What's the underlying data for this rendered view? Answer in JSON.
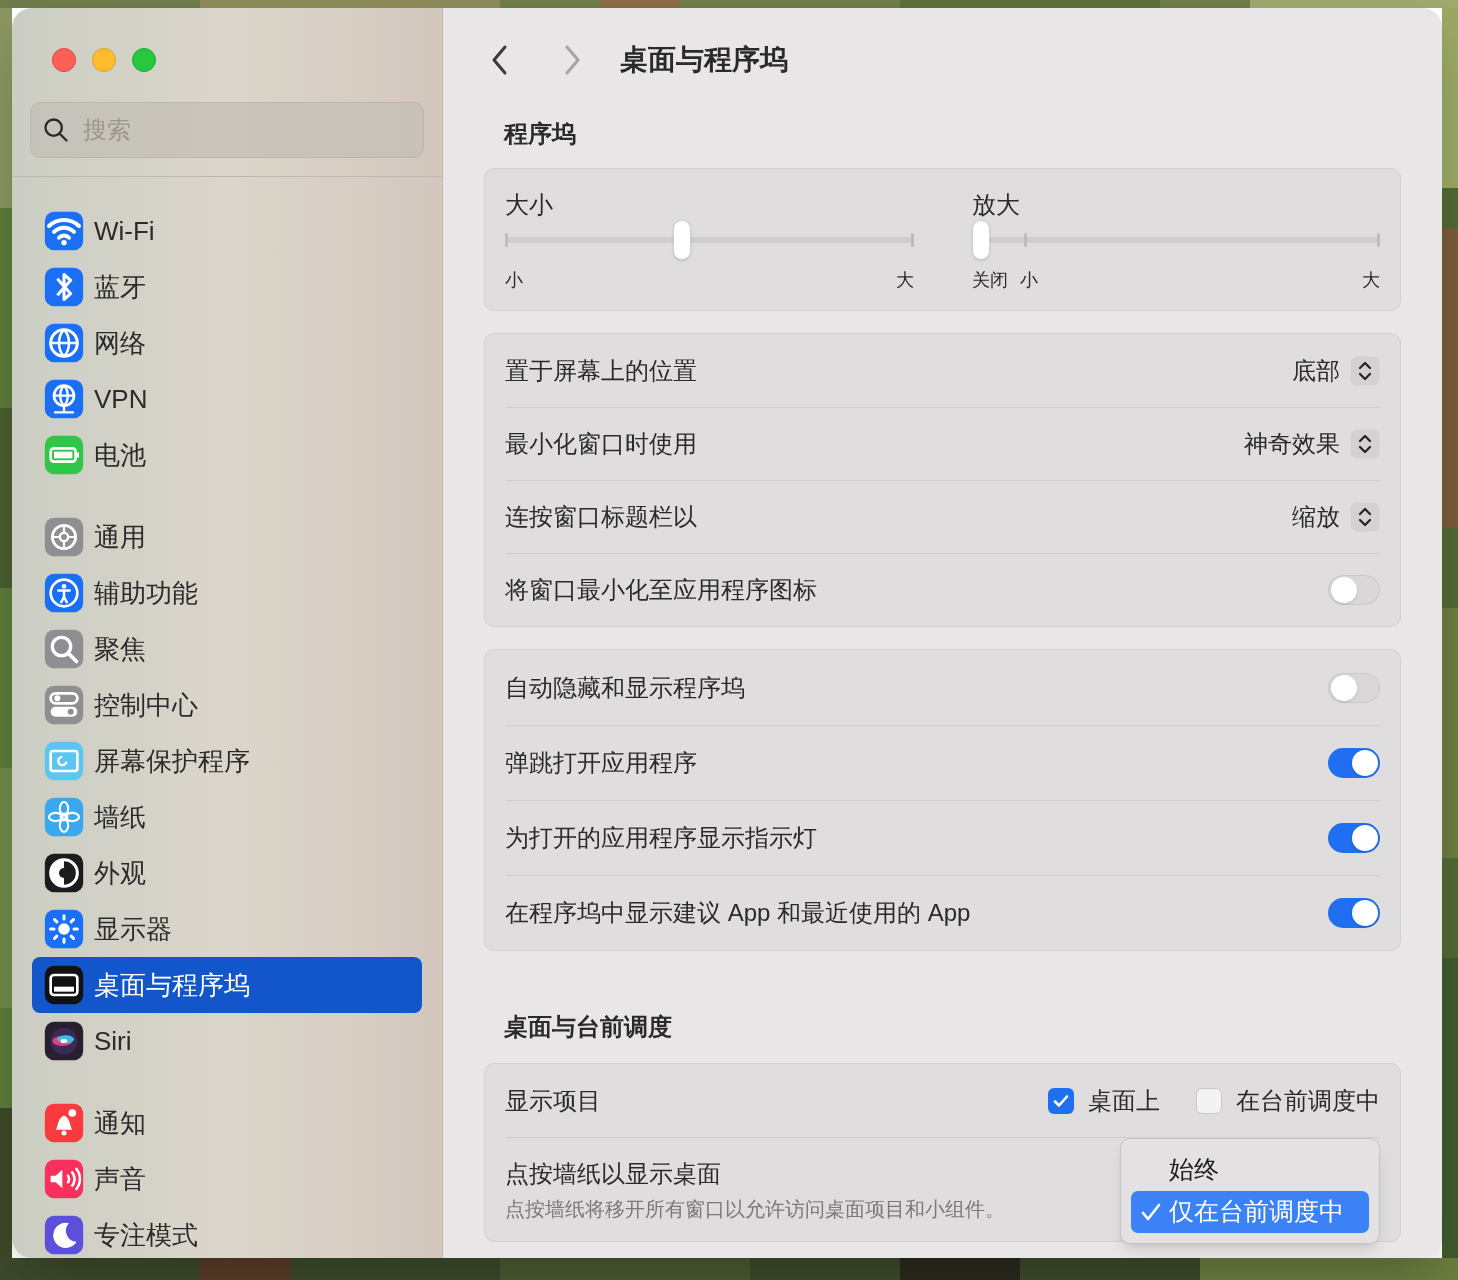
{
  "sidebar": {
    "search": {
      "placeholder": "搜索"
    },
    "groups": [
      [
        {
          "label": "Wi-Fi",
          "color": "#1b6ff5",
          "selected": false
        },
        {
          "label": "蓝牙",
          "color": "#1b6ff5",
          "selected": false
        },
        {
          "label": "网络",
          "color": "#1b6ff5",
          "selected": false
        },
        {
          "label": "VPN",
          "color": "#1b6ff5",
          "selected": false
        },
        {
          "label": "电池",
          "color": "#30c748",
          "selected": false
        }
      ],
      [
        {
          "label": "通用",
          "color": "#8e8e93",
          "selected": false
        },
        {
          "label": "辅助功能",
          "color": "#1b6ff5",
          "selected": false
        },
        {
          "label": "聚焦",
          "color": "#8e8e93",
          "selected": false
        },
        {
          "label": "控制中心",
          "color": "#8e8e93",
          "selected": false
        },
        {
          "label": "屏幕保护程序",
          "color": "#5cc6f2",
          "selected": false
        },
        {
          "label": "墙纸",
          "color": "#3aa8ef",
          "selected": false
        },
        {
          "label": "外观",
          "color": "#1c1c1e",
          "selected": false
        },
        {
          "label": "显示器",
          "color": "#1b6ff5",
          "selected": false
        },
        {
          "label": "桌面与程序坞",
          "color": "#111111",
          "selected": true
        },
        {
          "label": "Siri",
          "color": "#2a1f2e",
          "selected": false
        }
      ],
      [
        {
          "label": "通知",
          "color": "#fb3a3f",
          "selected": false
        },
        {
          "label": "声音",
          "color": "#fb2f5c",
          "selected": false
        },
        {
          "label": "专注模式",
          "color": "#5b4fdc",
          "selected": false
        }
      ]
    ]
  },
  "header": {
    "title": "桌面与程序坞"
  },
  "sections": [
    {
      "title": "程序坞",
      "cards": [
        {
          "kind": "sliders",
          "sliders": [
            {
              "label": "大小",
              "level": 0.43,
              "ticks": [
                "小",
                "大"
              ]
            },
            {
              "label": "放大",
              "level": 0,
              "ticks": [
                "关闭",
                "小",
                "大"
              ]
            }
          ]
        },
        {
          "kind": "rows",
          "rows": [
            {
              "kind": "popup",
              "label": "置于屏幕上的位置",
              "value": "底部"
            },
            {
              "kind": "popup",
              "label": "最小化窗口时使用",
              "value": "神奇效果"
            },
            {
              "kind": "popup",
              "label": "连按窗口标题栏以",
              "value": "缩放"
            },
            {
              "kind": "toggle",
              "label": "将窗口最小化至应用程序图标",
              "on": false
            }
          ]
        },
        {
          "kind": "rows",
          "rows": [
            {
              "kind": "toggle",
              "label": "自动隐藏和显示程序坞",
              "on": false
            },
            {
              "kind": "toggle",
              "label": "弹跳打开应用程序",
              "on": true
            },
            {
              "kind": "toggle",
              "label": "为打开的应用程序显示指示灯",
              "on": true
            },
            {
              "kind": "toggle",
              "label": "在程序坞中显示建议 App 和最近使用的 App",
              "on": true
            }
          ]
        }
      ]
    },
    {
      "title": "桌面与台前调度",
      "cards": [
        {
          "kind": "rows",
          "rows": [
            {
              "kind": "checkboxes",
              "label": "显示项目",
              "options": [
                {
                  "label": "桌面上",
                  "checked": true
                },
                {
                  "label": "在台前调度中",
                  "checked": false
                }
              ]
            },
            {
              "kind": "menu",
              "label": "点按墙纸以显示桌面",
              "description": "点按墙纸将移开所有窗口以允许访问桌面项目和小组件。",
              "menu": [
                {
                  "label": "始终",
                  "selected": false
                },
                {
                  "label": "仅在台前调度中",
                  "selected": true
                }
              ]
            }
          ]
        }
      ]
    }
  ]
}
